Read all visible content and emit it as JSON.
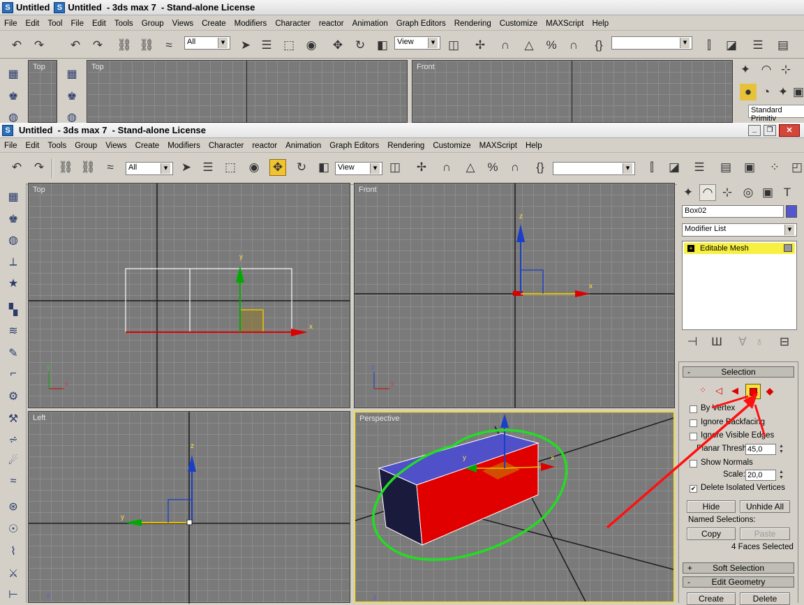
{
  "back_window": {
    "tab_label": "Untitled",
    "title": "Untitled  - 3ds max 7  - Stand-alone License",
    "menu": [
      "File",
      "Edit",
      "Tool",
      "File",
      "Edit",
      "Tools",
      "Group",
      "Views",
      "Create",
      "Modifiers",
      "Character",
      "reactor",
      "Animation",
      "Graph Editors",
      "Rendering",
      "Customize",
      "MAXScript",
      "Help"
    ],
    "selection_filter": "All",
    "ref_coord": "View",
    "viewports": [
      "Top",
      "Top",
      "Front"
    ],
    "creation_type": "Standard Primitiv"
  },
  "window": {
    "title": "Untitled  - 3ds max 7  - Stand-alone License",
    "menu": [
      "File",
      "Edit",
      "Tools",
      "Group",
      "Views",
      "Create",
      "Modifiers",
      "Character",
      "reactor",
      "Animation",
      "Graph Editors",
      "Rendering",
      "Customize",
      "MAXScript",
      "Help"
    ],
    "selection_filter": "All",
    "ref_coord": "View"
  },
  "viewports": {
    "top": {
      "label": "Top",
      "axis_y": "y",
      "axis_x": "x"
    },
    "front": {
      "label": "Front",
      "axis_z": "z",
      "axis_x": "x"
    },
    "left": {
      "label": "Left",
      "axis_z": "z",
      "axis_y": "y"
    },
    "perspective": {
      "label": "Perspective",
      "axis_y": "y",
      "axis_x": "x",
      "axis_z": "z"
    }
  },
  "command_panel": {
    "object_name": "Box02",
    "object_color": "#5555cc",
    "modifier_list": "Modifier List",
    "stack_item": "Editable Mesh",
    "selection": {
      "title": "Selection",
      "collapse_symbol": "-",
      "active_level": "polygon",
      "by_vertex": "By Vertex",
      "ignore_backfacing": "Ignore Backfacing",
      "ignore_visible_edges": "Ignore Visible Edges",
      "planar_thresh_label": "Planar Thresh:",
      "planar_thresh": "45,0",
      "show_normals": "Show Normals",
      "scale_label": "Scale:",
      "scale": "20,0",
      "delete_isolated": "Delete Isolated Vertices",
      "delete_isolated_checked": true,
      "hide": "Hide",
      "unhide_all": "Unhide All",
      "named_selections": "Named Selections:",
      "copy": "Copy",
      "paste": "Paste",
      "status": "4 Faces Selected"
    },
    "soft_selection": {
      "title": "Soft Selection",
      "symbol": "+"
    },
    "edit_geometry": {
      "title": "Edit Geometry",
      "symbol": "-",
      "create": "Create",
      "delete": "Delete"
    }
  },
  "annotation_colors": {
    "arrow": "#ff1010",
    "outline": "#22dd22"
  }
}
